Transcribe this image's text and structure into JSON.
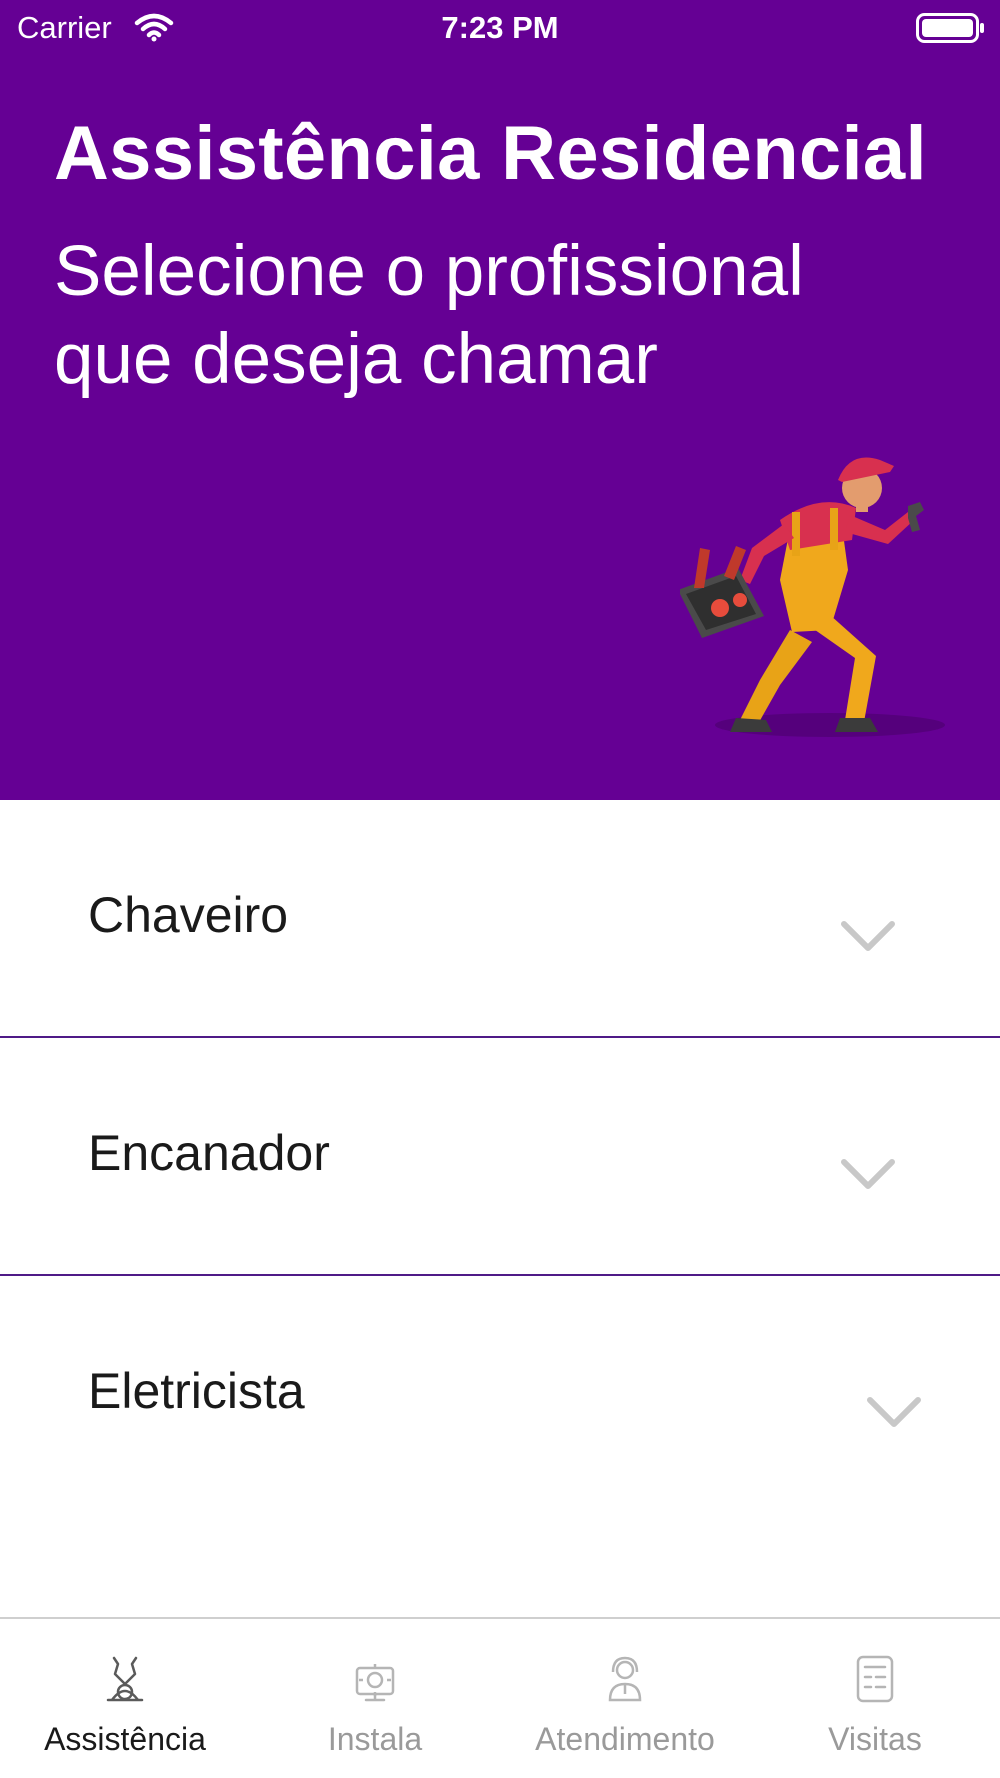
{
  "status_bar": {
    "carrier": "Carrier",
    "time": "7:23 PM",
    "wifi_icon": "wifi-icon",
    "battery_icon": "battery-icon"
  },
  "header": {
    "title": "Assistência Residencial",
    "subtitle": "Selecione o profissional que deseja chamar",
    "background_color": "#650094",
    "illustration": "running-repairman-with-toolbox"
  },
  "services": [
    {
      "label": "Chaveiro",
      "icon": "chevron-down-icon"
    },
    {
      "label": "Encanador",
      "icon": "chevron-down-icon"
    },
    {
      "label": "Eletricista",
      "icon": "chevron-down-icon"
    }
  ],
  "tab_bar": {
    "tabs": [
      {
        "label": "Assistência",
        "icon": "repair-tools-icon",
        "active": true
      },
      {
        "label": "Instala",
        "icon": "installation-gear-icon",
        "active": false
      },
      {
        "label": "Atendimento",
        "icon": "support-agent-icon",
        "active": false
      },
      {
        "label": "Visitas",
        "icon": "checklist-icon",
        "active": false
      }
    ]
  },
  "colors": {
    "accent": "#650094",
    "divider": "#4f1a87",
    "tab_active": "#1a1a1a",
    "tab_inactive": "#9a9a9a"
  }
}
